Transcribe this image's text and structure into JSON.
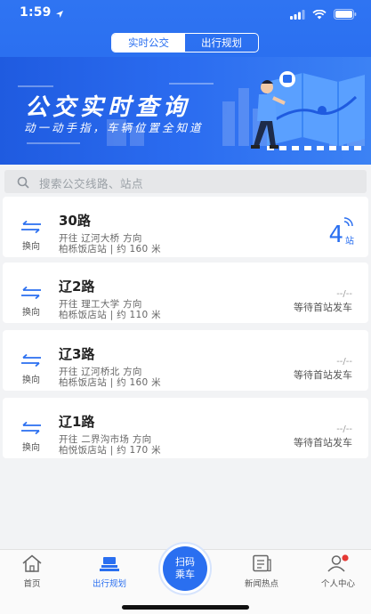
{
  "status": {
    "time": "1:59"
  },
  "segment": {
    "tabs": [
      "实时公交",
      "出行规划"
    ]
  },
  "banner": {
    "title": "公交实时查询",
    "subtitle": "动一动手指，车辆位置全知道"
  },
  "search": {
    "placeholder": "搜索公交线路、站点"
  },
  "swap_label": "换向",
  "routes": [
    {
      "name": "30路",
      "direction": "开往 辽河大桥 方向",
      "stop": "柏栎饭店站 | 约 160 米",
      "eta_number": "4",
      "eta_unit": "站"
    },
    {
      "name": "辽2路",
      "direction": "开往 理工大学 方向",
      "stop": "柏栎饭店站 | 约 110 米",
      "eta_dash": "--/--",
      "eta_text": "等待首站发车"
    },
    {
      "name": "辽3路",
      "direction": "开往 辽河桥北 方向",
      "stop": "柏栎饭店站 | 约 160 米",
      "eta_dash": "--/--",
      "eta_text": "等待首站发车"
    },
    {
      "name": "辽1路",
      "direction": "开往 二界沟市场 方向",
      "stop": "柏悦饭店站 | 约 170 米",
      "eta_dash": "--/--",
      "eta_text": "等待首站发车"
    }
  ],
  "tabbar": {
    "items": [
      "首页",
      "出行规划",
      "新闻热点",
      "个人中心"
    ],
    "scan": [
      "扫码",
      "乘车"
    ]
  },
  "colors": {
    "primary": "#2a6ff0",
    "badge": "#e53935"
  }
}
